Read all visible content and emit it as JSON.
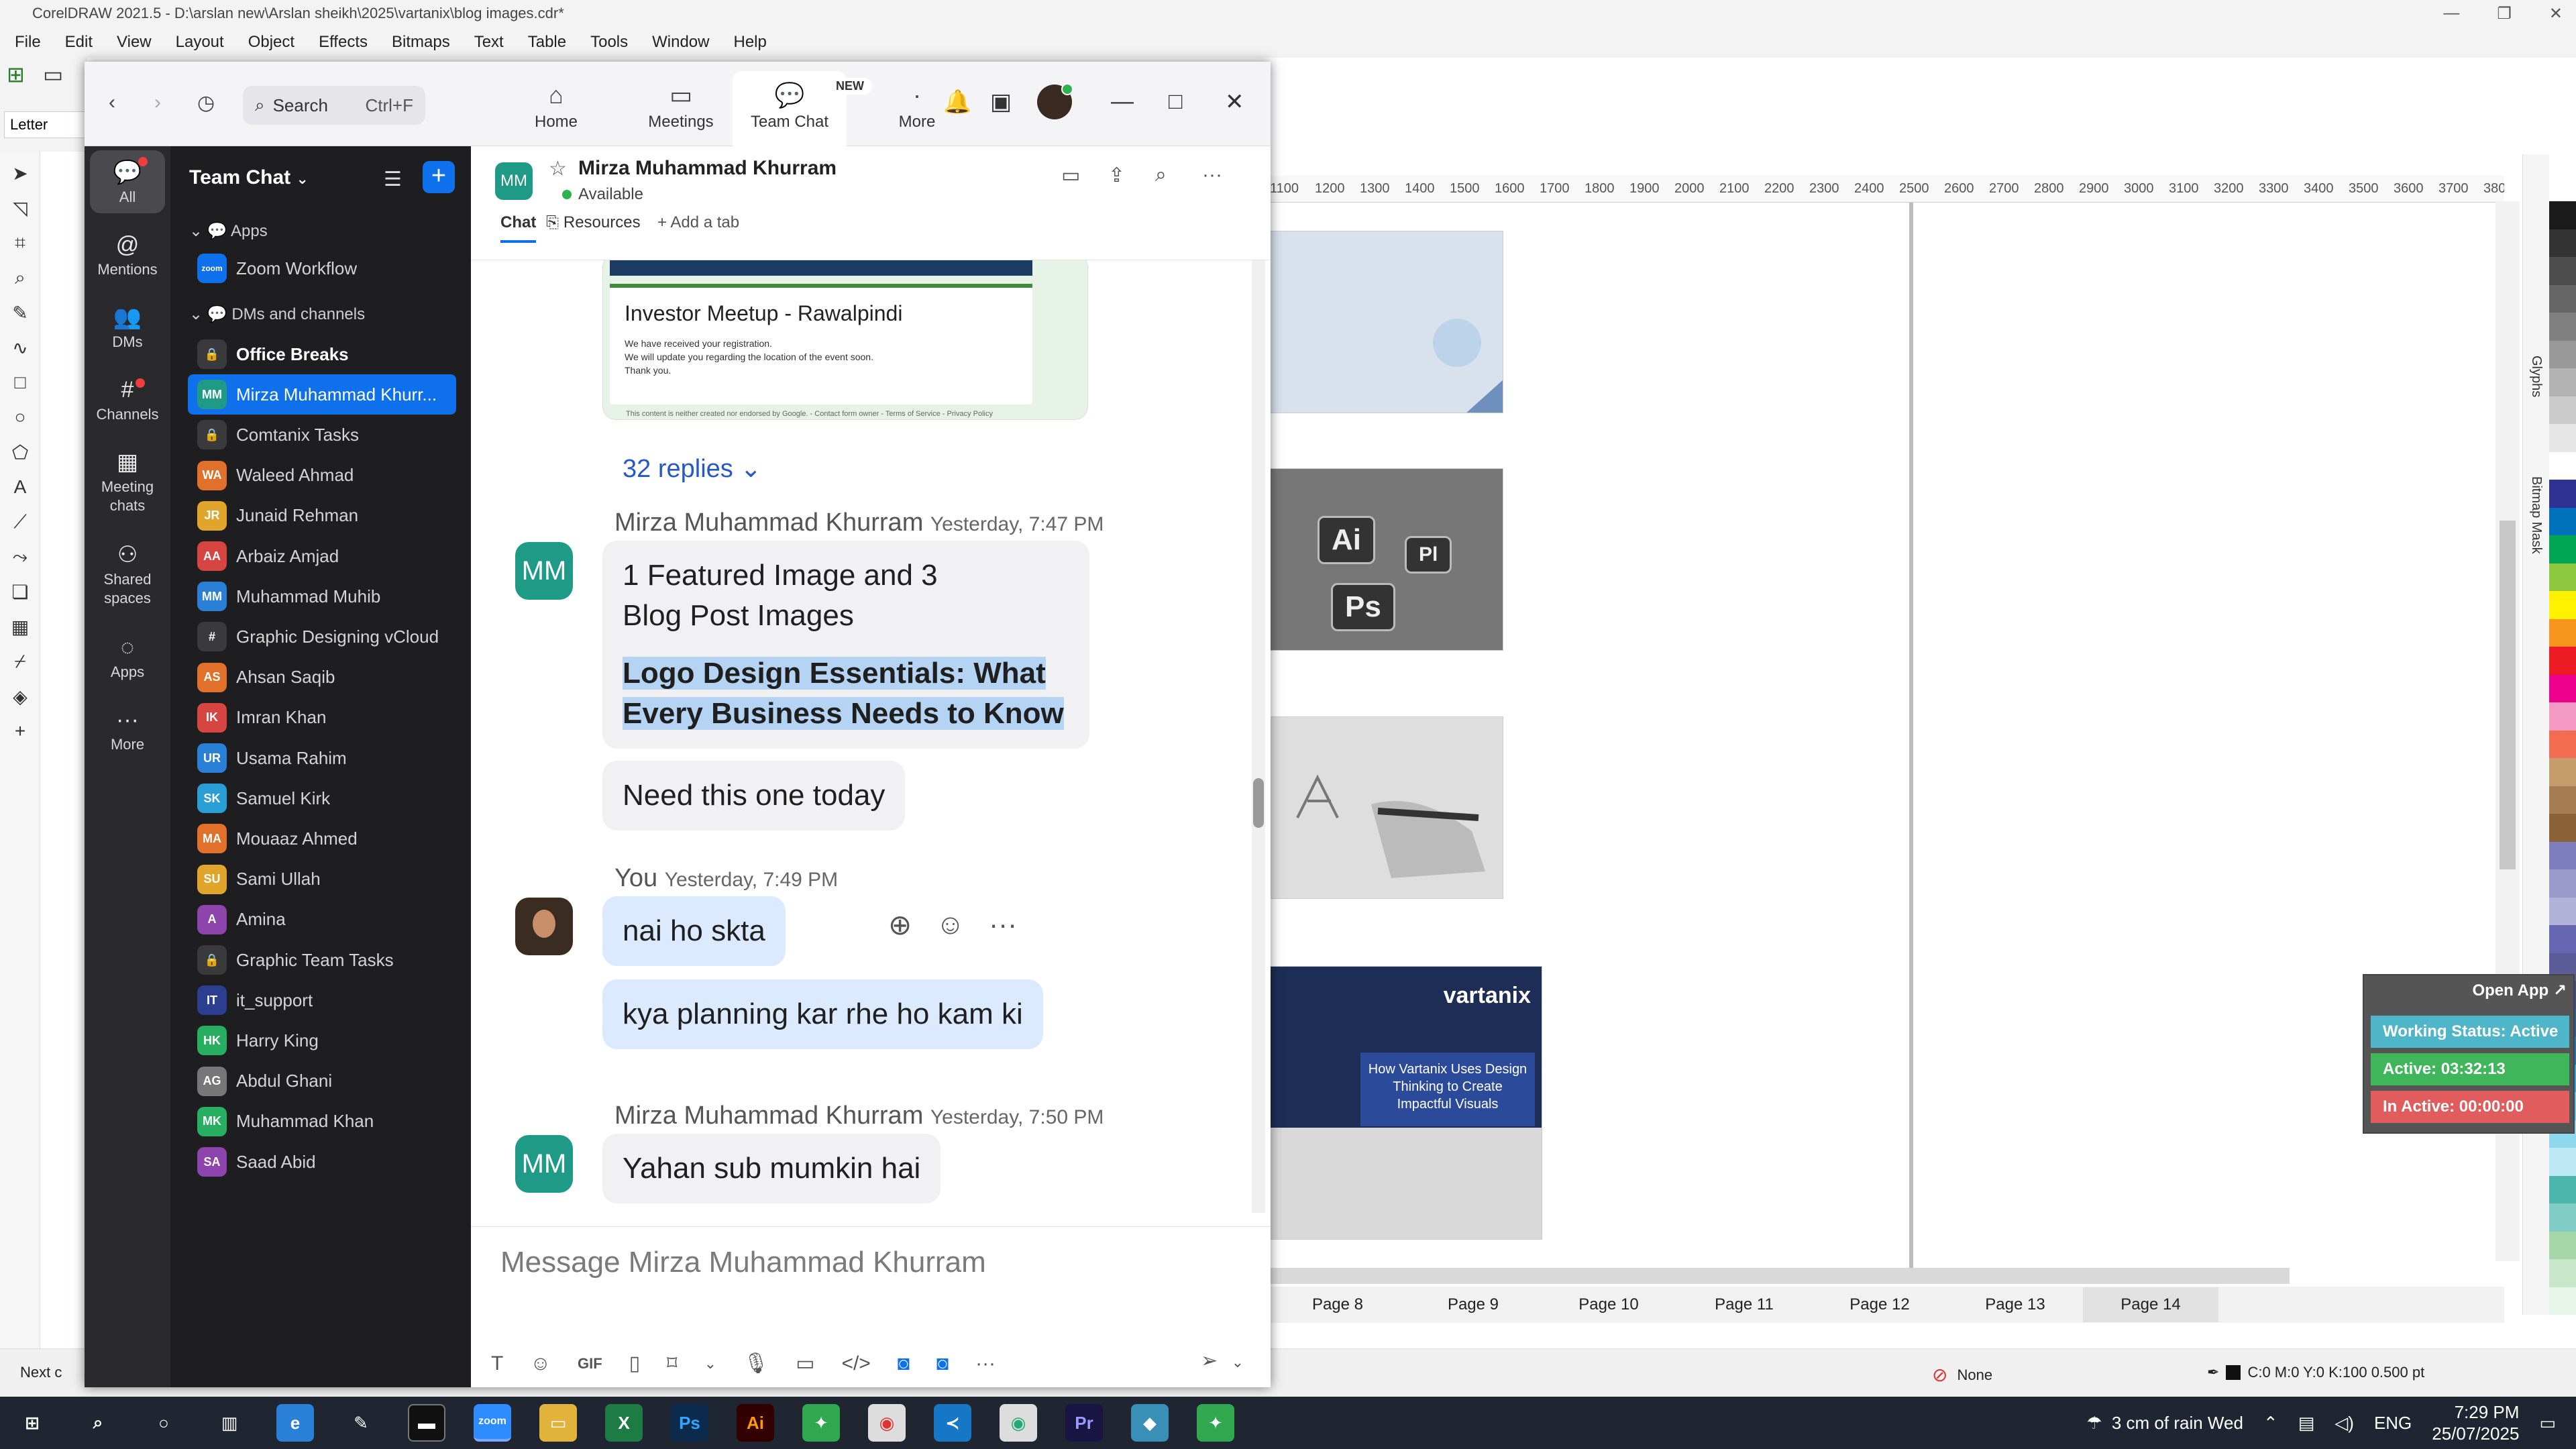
{
  "corel": {
    "title": "CorelDRAW 2021.5 - D:\\arslan new\\Arslan sheikh\\2025\\vartanix\\blog images.cdr*",
    "menu": [
      "File",
      "Edit",
      "View",
      "Layout",
      "Object",
      "Effects",
      "Bitmaps",
      "Text",
      "Table",
      "Tools",
      "Window",
      "Help"
    ],
    "paper_size": "Letter",
    "ruler_ticks": [
      "1100",
      "1200",
      "1300",
      "1400",
      "1500",
      "1600",
      "1700",
      "1800",
      "1900",
      "2000",
      "2100",
      "2200",
      "2300",
      "2400",
      "2500",
      "2600",
      "2700",
      "2800",
      "2900",
      "3000",
      "3100",
      "3200",
      "3300",
      "3400",
      "3500",
      "3600",
      "3700",
      "3800"
    ],
    "ruler_unit": "pixels",
    "pages": [
      "Page 8",
      "Page 9",
      "Page 10",
      "Page 11",
      "Page 12",
      "Page 13",
      "Page 14"
    ],
    "active_page": "Page 14",
    "status_next": "Next c",
    "fill_label": "None",
    "outline_label": "C:0 M:0 Y:0 K:100  0.500 pt",
    "docker_labels": [
      "Glyphs",
      "Bitmap Mask"
    ],
    "thumb_ai": [
      "Ai",
      "Pl",
      "Ps"
    ],
    "thumb4_brand": "vartanix",
    "thumb4_caption": "How Vartanix Uses Design Thinking to Create Impactful Visuals",
    "palette": [
      "#1a1a1a",
      "#333333",
      "#4d4d4d",
      "#666666",
      "#808080",
      "#999999",
      "#b3b3b3",
      "#cccccc",
      "#e6e6e6",
      "#ffffff",
      "#2e3192",
      "#0072bc",
      "#00a651",
      "#8dc63f",
      "#fff200",
      "#f7941d",
      "#ed1c24",
      "#ec008c",
      "#f49ac2",
      "#f26c4f",
      "#c69c6d",
      "#a67c52",
      "#8c6239",
      "#7f7fbf",
      "#9999cc",
      "#b3b3d9",
      "#6666b3",
      "#5c5c99",
      "#3f4c8a",
      "#2b5c9a",
      "#1b75bc",
      "#27aae1",
      "#5fc5e6",
      "#8ed8ef",
      "#bfe8f5",
      "#4db6ac",
      "#80cbc4",
      "#a5d6a7",
      "#c8e6c9",
      "#e8f5e9"
    ]
  },
  "work_status": {
    "open_app": "Open App ↗",
    "status": "Working Status: Active",
    "active": "Active: 03:32:13",
    "inactive": "In Active: 00:00:00"
  },
  "taskbar": {
    "weather": "3 cm of rain Wed",
    "lang": "ENG",
    "time": "7:29 PM",
    "date": "25/07/2025",
    "apps": [
      "Ps",
      "Ai",
      "Pr"
    ]
  },
  "zoom": {
    "search_placeholder": "Search",
    "search_shortcut": "Ctrl+F",
    "tabs": [
      "Home",
      "Meetings",
      "Team Chat",
      "More"
    ],
    "new_badge": "NEW",
    "rail": [
      "All",
      "Mentions",
      "DMs",
      "Channels",
      "Meeting chats",
      "Shared spaces",
      "Apps",
      "More"
    ],
    "list_title": "Team Chat",
    "sections": [
      "Apps",
      "DMs and channels"
    ],
    "apps_items": [
      {
        "name": "Zoom Workflow",
        "initials": "zoom"
      }
    ],
    "items": [
      {
        "name": "Office Breaks",
        "initials": "",
        "color": "#3a3a3d",
        "bold": true
      },
      {
        "name": "Mirza Muhammad Khurr...",
        "initials": "MM",
        "color": "#1f9a87",
        "selected": true
      },
      {
        "name": "Comtanix Tasks",
        "initials": "",
        "color": "#3a3a3d"
      },
      {
        "name": "Waleed Ahmad",
        "initials": "WA",
        "color": "#e0702a"
      },
      {
        "name": "Junaid Rehman",
        "initials": "JR",
        "color": "#e0a52a"
      },
      {
        "name": "Arbaiz Amjad",
        "initials": "AA",
        "color": "#d64541"
      },
      {
        "name": "Muhammad Muhib",
        "initials": "MM",
        "color": "#2a7fd6"
      },
      {
        "name": "Graphic Designing vCloud",
        "initials": "#",
        "color": "#3a3a3d"
      },
      {
        "name": "Ahsan Saqib",
        "initials": "AS",
        "color": "#e0702a"
      },
      {
        "name": "Imran Khan",
        "initials": "IK",
        "color": "#d64541"
      },
      {
        "name": "Usama Rahim",
        "initials": "UR",
        "color": "#2a7fd6"
      },
      {
        "name": "Samuel Kirk",
        "initials": "SK",
        "color": "#2a9fd6"
      },
      {
        "name": "Mouaaz Ahmed",
        "initials": "MA",
        "color": "#e0702a"
      },
      {
        "name": "Sami Ullah",
        "initials": "SU",
        "color": "#e0a52a"
      },
      {
        "name": "Amina",
        "initials": "A",
        "color": "#8e44ad"
      },
      {
        "name": "Graphic Team Tasks",
        "initials": "",
        "color": "#3a3a3d"
      },
      {
        "name": "it_support",
        "initials": "IT",
        "color": "#2c3e8f"
      },
      {
        "name": "Harry King",
        "initials": "HK",
        "color": "#27ae60"
      },
      {
        "name": "Abdul Ghani",
        "initials": "AG",
        "color": "#777777"
      },
      {
        "name": "Muhammad Khan",
        "initials": "MK",
        "color": "#27ae60"
      },
      {
        "name": "Saad Abid",
        "initials": "SA",
        "color": "#8e44ad"
      }
    ],
    "chat": {
      "name": "Mirza Muhammad Khurram",
      "initials": "MM",
      "presence": "Available",
      "tabs": [
        "Chat",
        "Resources",
        "+ Add a tab"
      ],
      "card_title": "Investor Meetup - Rawalpindi",
      "card_lines": [
        "We have received your registration.",
        "We will update you regarding the location of the event soon.",
        "Thank you."
      ],
      "card_footer": "This content is neither created nor endorsed by Google. - Contact form owner - Terms of Service - Privacy Policy",
      "replies": "32 replies",
      "messages": [
        {
          "sender": "Mirza Muhammad Khurram",
          "time": "Yesterday, 7:47 PM",
          "texts": [
            "1 Featured Image and 3 Blog Post Images",
            "Logo Design Essentials: What Every Business Needs to Know",
            "Need this one today"
          ]
        },
        {
          "sender": "You",
          "time": "Yesterday, 7:49 PM",
          "texts": [
            "nai ho skta",
            "kya planning kar rhe ho kam ki"
          ]
        },
        {
          "sender": "Mirza Muhammad Khurram",
          "time": "Yesterday, 7:50 PM",
          "texts": [
            "Yahan sub mumkin hai"
          ]
        }
      ],
      "composer_placeholder": "Message Mirza Muhammad Khurram"
    }
  }
}
